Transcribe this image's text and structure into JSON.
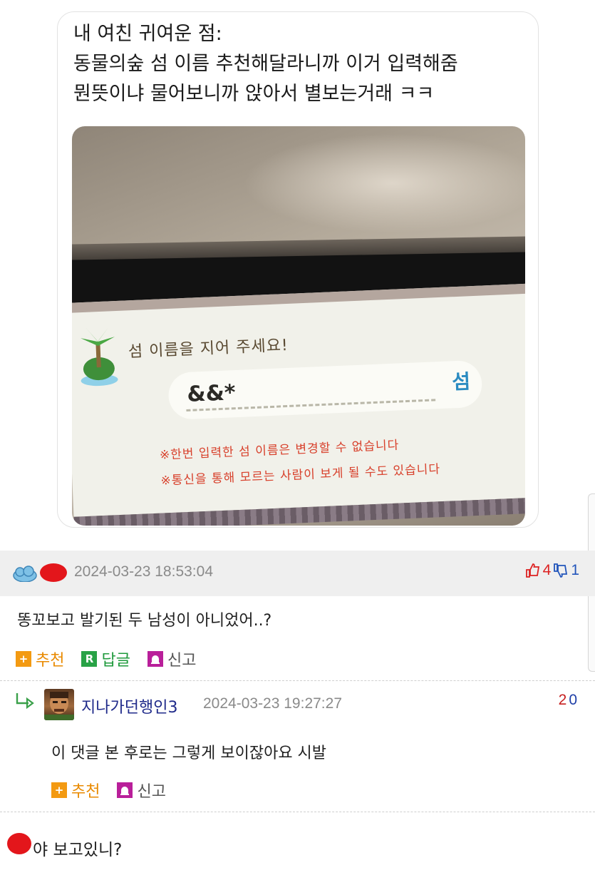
{
  "post": {
    "lines": [
      "내 여친 귀여운 점:",
      "동물의숲 섬 이름 추천해달라니까 이거 입력해줌",
      "뭔뜻이냐 물어보니까 앉아서 별보는거래 ㅋㅋ"
    ],
    "photo": {
      "prompt": "섬 이름을 지어 주세요!",
      "name_value": "&&*",
      "name_suffix": "섬",
      "warning_1": "※한번 입력한 섬 이름은 변경할 수 없습니다",
      "warning_2": "※통신을 통해 모르는 사람이 보게 될 수도 있습니다"
    }
  },
  "comments": [
    {
      "timestamp": "2024-03-23 18:53:04",
      "upvotes": "4",
      "downvotes": "1",
      "body": "똥꼬보고 발기된 두 남성이 아니었어..?",
      "actions": {
        "recommend": "추천",
        "reply": "답글",
        "report": "신고"
      },
      "action_icons": {
        "recommend": "+",
        "reply": "R"
      }
    },
    {
      "author": "지나가던행인3",
      "timestamp": "2024-03-23 19:27:27",
      "score_up": "2",
      "score_down": "0",
      "body": "이 댓글 본 후로는 그렇게 보이잖아요 시발",
      "actions": {
        "recommend": "추천",
        "report": "신고"
      },
      "action_icons": {
        "recommend": "+"
      }
    },
    {
      "body": "야 보고있니?"
    }
  ],
  "colors": {
    "recommend": "#f39a12",
    "reply": "#28a246",
    "report": "#b91f9a",
    "author": "#1f2a8a",
    "upvote": "#dd2222",
    "downvote": "#2255bb"
  },
  "icons": {
    "reply_indicator": "reply-arrow-icon",
    "vote_up": "thumbs-up-icon",
    "vote_down": "thumbs-down-icon",
    "report": "siren-icon"
  }
}
